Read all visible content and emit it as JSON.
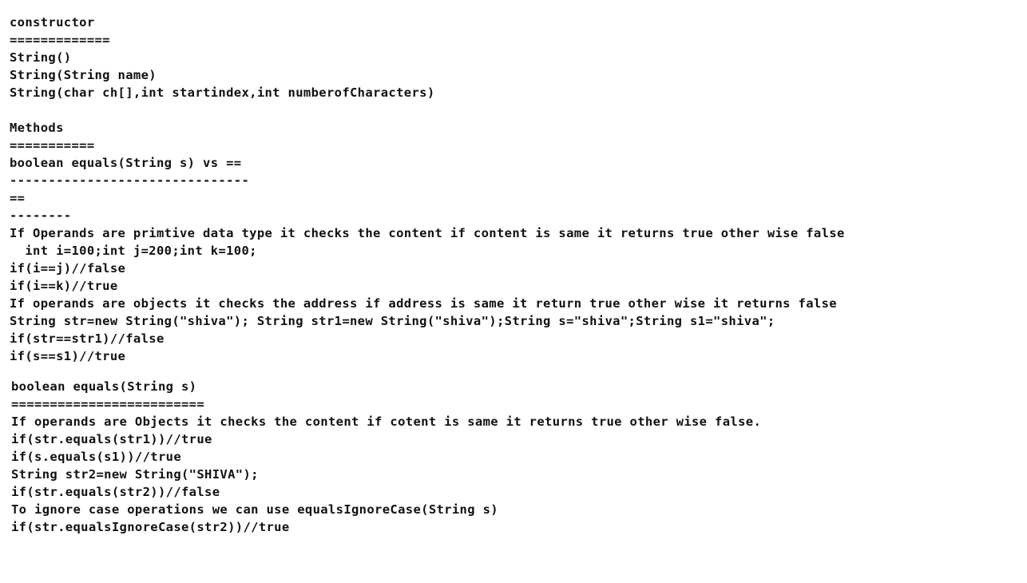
{
  "section1": {
    "lines": [
      "constructor",
      "=============",
      "String()",
      "String(String name)",
      "String(char ch[],int startindex,int numberofCharacters)",
      "",
      "Methods",
      "===========",
      "boolean equals(String s) vs ==",
      "-------------------------------",
      "==",
      "--------",
      "If Operands are primtive data type it checks the content if content is same it returns true other wise false",
      "  int i=100;int j=200;int k=100;",
      "if(i==j)//false",
      "if(i==k)//true",
      "If operands are objects it checks the address if address is same it return true other wise it returns false",
      "String str=new String(\"shiva\"); String str1=new String(\"shiva\");String s=\"shiva\";String s1=\"shiva\";",
      "if(str==str1)//false",
      "if(s==s1)//true"
    ]
  },
  "section2": {
    "lines": [
      "boolean equals(String s)",
      "=========================",
      "If operands are Objects it checks the content if cotent is same it returns true other wise false.",
      "if(str.equals(str1))//true",
      "if(s.equals(s1))//true",
      "String str2=new String(\"SHIVA\");",
      "if(str.equals(str2))//false",
      "To ignore case operations we can use equalsIgnoreCase(String s)",
      "if(str.equalsIgnoreCase(str2))//true"
    ]
  }
}
